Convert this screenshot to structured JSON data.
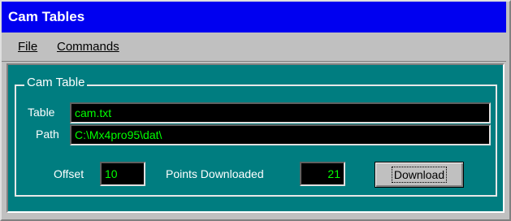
{
  "window": {
    "title": "Cam Tables"
  },
  "menu": {
    "file": "File",
    "commands": "Commands"
  },
  "group": {
    "title": "Cam Table",
    "table_label": "Table",
    "table_value": "cam.txt",
    "path_label": "Path",
    "path_value": "C:\\Mx4pro95\\dat\\",
    "offset_label": "Offset",
    "offset_value": "10",
    "points_label": "Points Downloaded",
    "points_value": "21",
    "download_label": "Download"
  },
  "colors": {
    "titlebar": "#0000f0",
    "client": "#007d80",
    "field_text": "#00ff00",
    "field_bg": "#000000"
  }
}
